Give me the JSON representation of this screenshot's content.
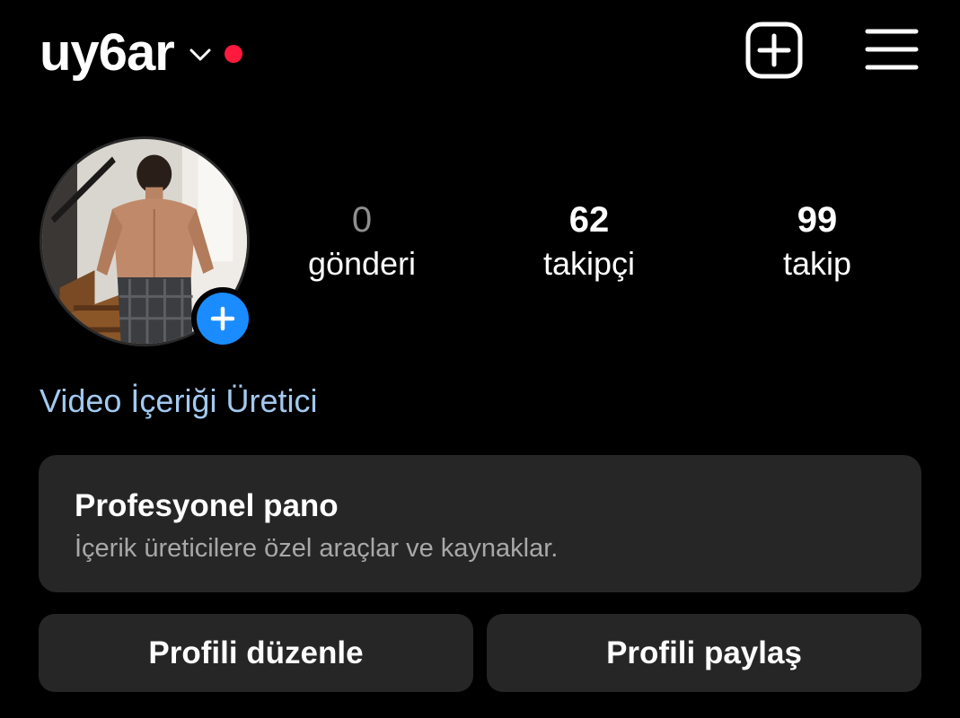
{
  "colors": {
    "background": "#000000",
    "card": "#262626",
    "text": "#ffffff",
    "muted": "#8e8e8e",
    "link": "#a3c9ef",
    "notification_dot": "#ff1a3d",
    "story_add": "#1a8cff"
  },
  "header": {
    "username": "uy6ar",
    "account_switcher_icon": "chevron-down-icon",
    "new_post_icon": "plus-square-icon",
    "menu_icon": "hamburger-menu-icon"
  },
  "profile": {
    "avatar_icon": "profile-photo",
    "add_story_icon": "plus-circle-icon",
    "stats": {
      "posts_count": "0",
      "posts_label": "gönderi",
      "followers_count": "62",
      "followers_label": "takipçi",
      "following_count": "99",
      "following_label": "takip"
    },
    "category": "Video İçeriği Üretici"
  },
  "professional_dashboard": {
    "title": "Profesyonel pano",
    "subtitle": "İçerik üreticilere özel araçlar ve kaynaklar."
  },
  "actions": {
    "edit_profile": "Profili düzenle",
    "share_profile": "Profili paylaş"
  }
}
